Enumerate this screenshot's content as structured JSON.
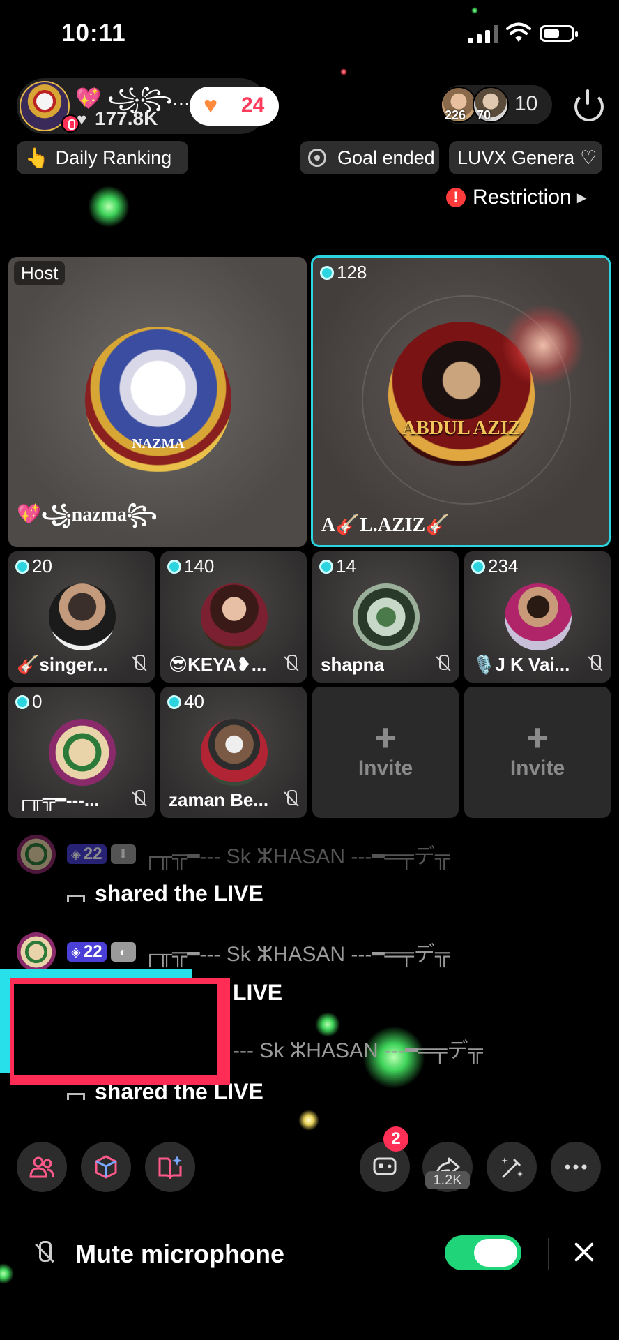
{
  "status_bar": {
    "time": "10:11"
  },
  "host": {
    "name": "💖 ꧁꧂...",
    "likes": "177.8K",
    "follow_count": "24"
  },
  "viewers": {
    "badge1": "226",
    "badge2": "70",
    "count": "10"
  },
  "badges": {
    "daily_ranking": "Daily Ranking",
    "goal": "Goal ended",
    "luvx": "LUVX Genera"
  },
  "restriction": "Restriction",
  "seats": {
    "host": {
      "tag": "Host",
      "name": "💖꧁nazma꧂🌟💫",
      "avatar_text": "NAZMA"
    },
    "guest": {
      "score": "128",
      "name": "A🎸L.AZIZ🎸",
      "avatar_text": "ABDUL AZIZ"
    },
    "small": [
      {
        "score": "20",
        "name": "🎸singer..."
      },
      {
        "score": "140",
        "name": "😎KEYA❥..."
      },
      {
        "score": "14",
        "name": "shapna"
      },
      {
        "score": "234",
        "name": "🎙️J K Vai..."
      },
      {
        "score": "0",
        "name": "┌╥╦━---..."
      },
      {
        "score": "40",
        "name": "zaman Be..."
      }
    ],
    "invite_label": "Invite"
  },
  "chat": [
    {
      "level": "22",
      "name": "┌╥╦━--- Sk ⵣHASAN ---━═╤デ╦",
      "message": "shared the LIVE"
    },
    {
      "level": "22",
      "name": "┌╥╦━--- Sk ⵣHASAN ---━═╤デ╦",
      "message": "LIVE"
    },
    {
      "name": "--- Sk ⵣHASAN ---━═╤デ╦",
      "message": "shared the LIVE"
    }
  ],
  "toolbar": {
    "notif_count": "2",
    "share_count": "1.2K"
  },
  "mute_bar": {
    "label": "Mute microphone",
    "toggle_on": true
  },
  "colors": {
    "accent_teal": "#2bd4df",
    "toggle_green": "#20d47a",
    "alert_red": "#ff2f55"
  }
}
